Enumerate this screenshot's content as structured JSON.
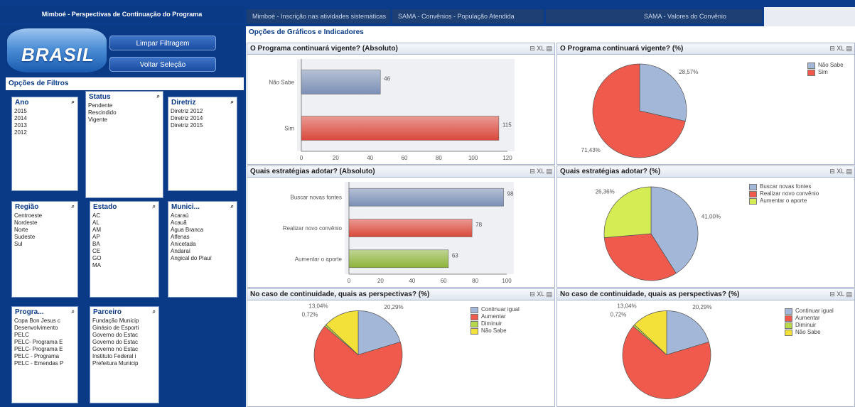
{
  "tabs": [
    {
      "label": "Mimboé - Perspectivas de Continuação do Programa"
    },
    {
      "label": "Mimboé - Inscrição nas atividades sistemáticas"
    },
    {
      "label": "SAMA - Convênios - População Atendida"
    },
    {
      "label": "SAMA - Valores do Convênio"
    }
  ],
  "logo_text": "BRASIL",
  "buttons": {
    "clear": "Limpar Filtragem",
    "back": "Voltar Seleção"
  },
  "filters_title": "Opções de Filtros",
  "listboxes": [
    {
      "title": "Ano",
      "items": [
        "2015",
        "2014",
        "2013",
        "2012"
      ]
    },
    {
      "title": "Status",
      "items": [
        "Pendente",
        "Rescindido",
        "Vigente"
      ]
    },
    {
      "title": "Diretriz",
      "items": [
        "Diretriz 2012",
        "Diretriz 2014",
        "Diretriz 2015"
      ]
    },
    {
      "title": "Região",
      "items": [
        "Centroeste",
        "Nordeste",
        "Norte",
        "Sudeste",
        "Sul"
      ]
    },
    {
      "title": "Estado",
      "items": [
        "AC",
        "AL",
        "AM",
        "AP",
        "BA",
        "CE",
        "GO",
        "MA"
      ]
    },
    {
      "title": "Munici...",
      "items": [
        "Acaraú",
        "Acauã",
        "Água Branca",
        "Alfenas",
        "Anicetada",
        "Andaraí",
        "Angical do Piauí"
      ]
    },
    {
      "title": "Progra...",
      "items": [
        "Copa Bon Jesus c",
        "Desenvolvimento",
        "PELC",
        "PELC- Programa E",
        "PELC- Programa E",
        "PELC - Programa",
        "PELC - Emendas P"
      ]
    },
    {
      "title": "Parceiro",
      "items": [
        "Fundação Municip",
        "Ginásio de Esporti",
        "Governo do Estac",
        "Governo do Estac",
        "Governo no Estac",
        "Instituto Federal i",
        "Prefeitura Municip"
      ]
    }
  ],
  "charts_title": "Opções de Gráficos e Indicadores",
  "panel_icons": "⊟ XL ▤",
  "chart_data": [
    {
      "type": "bar",
      "title": "O Programa continuará vigente? (Absoluto)",
      "categories": [
        "Não Sabe",
        "Sim"
      ],
      "values": [
        46,
        115
      ],
      "xlim": [
        0,
        120
      ],
      "ticks": [
        0,
        20,
        40,
        60,
        80,
        100,
        120
      ],
      "colors": [
        "#7b8fb5",
        "#d9483b"
      ]
    },
    {
      "type": "pie",
      "title": "O Programa continuará vigente? (%)",
      "series": [
        {
          "name": "Não Sabe",
          "value": 28.57,
          "label": "28,57%",
          "color": "#a3b7d8"
        },
        {
          "name": "Sim",
          "value": 71.43,
          "label": "71,43%",
          "color": "#ef5a4c"
        }
      ]
    },
    {
      "type": "bar",
      "title": "Quais estratégias adotar? (Absoluto)",
      "categories": [
        "Buscar novas fontes",
        "Realizar novo convênio",
        "Aumentar o aporte"
      ],
      "values": [
        98,
        78,
        63
      ],
      "xlim": [
        0,
        100
      ],
      "ticks": [
        0,
        20,
        40,
        60,
        80,
        100
      ],
      "colors": [
        "#7b8fb5",
        "#d9483b",
        "#8db33a"
      ]
    },
    {
      "type": "pie",
      "title": "Quais estratégias adotar? (%)",
      "series": [
        {
          "name": "Buscar novas fontes",
          "value": 41.0,
          "label": "41,00%",
          "color": "#a3b7d8"
        },
        {
          "name": "Realizar novo convênio",
          "value": 32.64,
          "label": "32,64%",
          "color": "#ef5a4c"
        },
        {
          "name": "Aumentar o aporte",
          "value": 26.36,
          "label": "26,36%",
          "color": "#d6ec55"
        }
      ]
    },
    {
      "type": "pie",
      "title": "No caso de continuidade, quais as perspectivas? (%)",
      "series": [
        {
          "name": "Continuar igual",
          "value": 20.29,
          "label": "20,29%",
          "color": "#a3b7d8"
        },
        {
          "name": "Aumentar",
          "value": 65.94,
          "label": "65,94%",
          "color": "#ef5a4c"
        },
        {
          "name": "Diminuir",
          "value": 0.72,
          "label": "0,72%",
          "color": "#b8d84c"
        },
        {
          "name": "Não Sabe",
          "value": 13.04,
          "label": "13,04%",
          "color": "#f3e13a"
        }
      ]
    },
    {
      "type": "pie",
      "title": "No caso de continuidade, quais as perspectivas? (%)",
      "series": [
        {
          "name": "Continuar igual",
          "value": 20.29,
          "label": "20,29%",
          "color": "#a3b7d8"
        },
        {
          "name": "Aumentar",
          "value": 65.94,
          "label": "65,94%",
          "color": "#ef5a4c"
        },
        {
          "name": "Diminuir",
          "value": 0.72,
          "label": "0,72%",
          "color": "#b8d84c"
        },
        {
          "name": "Não Sabe",
          "value": 13.04,
          "label": "13,04%",
          "color": "#f3e13a"
        }
      ]
    }
  ]
}
